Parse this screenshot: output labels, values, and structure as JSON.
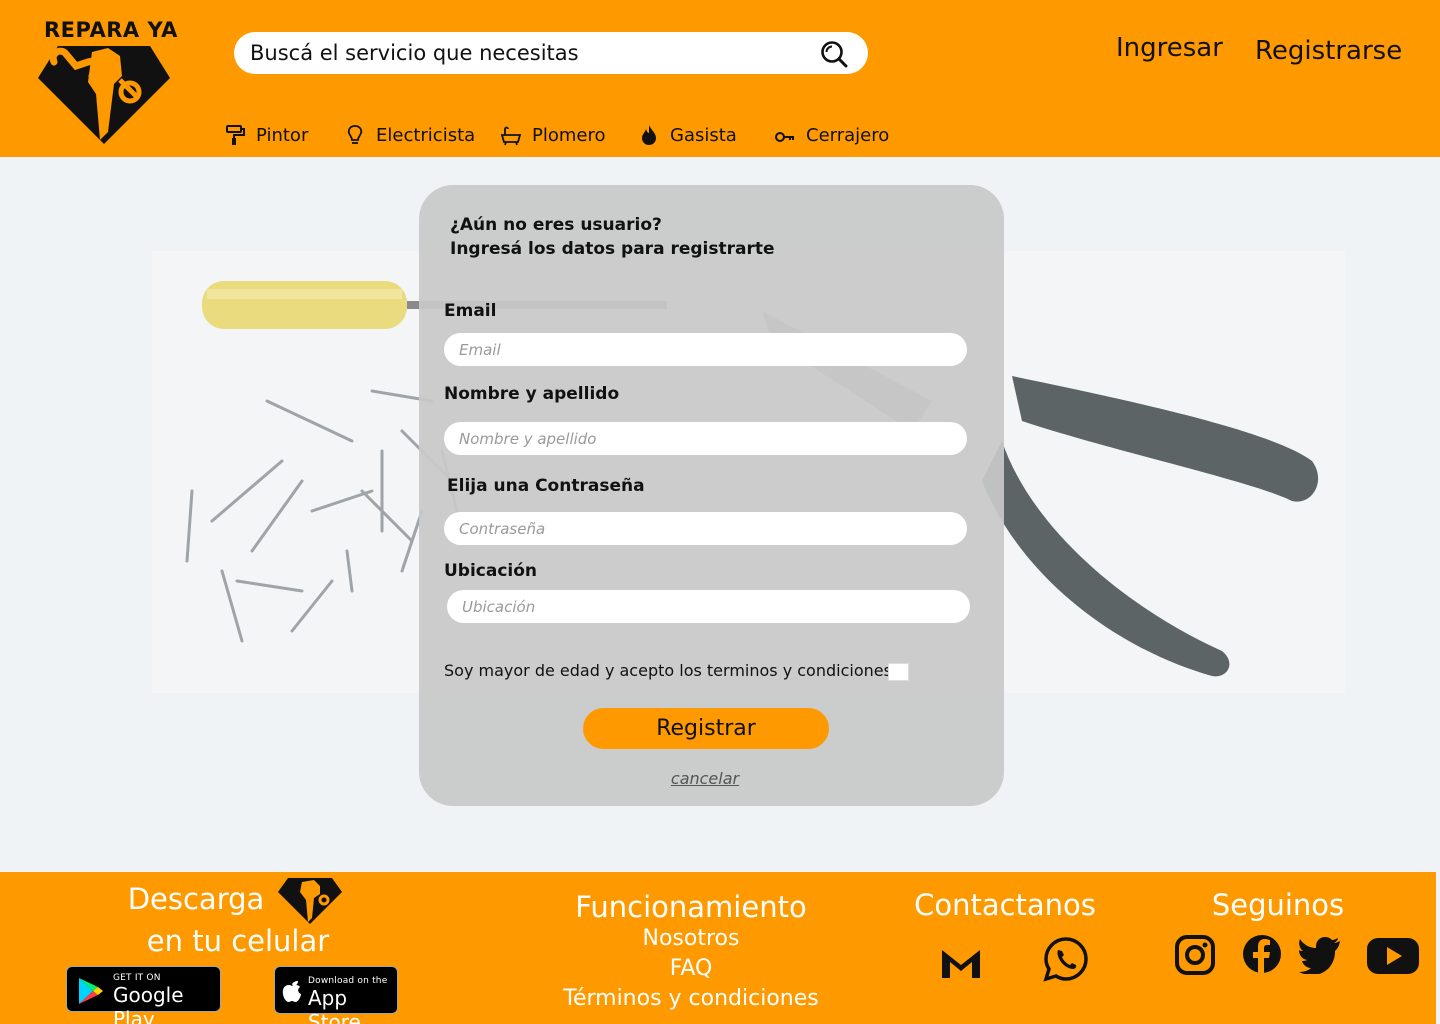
{
  "brand": {
    "name": "REPARA YA"
  },
  "search": {
    "placeholder": "Buscá el servicio que necesitas"
  },
  "auth": {
    "login": "Ingresar",
    "register": "Registrarse"
  },
  "nav": [
    {
      "label": "Pintor",
      "icon": "paint-roller-icon"
    },
    {
      "label": "Electricista",
      "icon": "lightbulb-icon"
    },
    {
      "label": "Plomero",
      "icon": "bathtub-icon"
    },
    {
      "label": "Gasista",
      "icon": "flame-icon"
    },
    {
      "label": "Cerrajero",
      "icon": "key-icon"
    }
  ],
  "form": {
    "intro_line1": "¿Aún no eres usuario?",
    "intro_line2": "Ingresá los datos para registrarte",
    "email_label": "Email",
    "email_placeholder": "Email",
    "name_label": "Nombre y apellido",
    "name_placeholder": "Nombre y apellido",
    "password_label": "Elija una Contraseña",
    "password_placeholder": "Contraseña",
    "location_label": "Ubicación",
    "location_placeholder": "Ubicación",
    "terms": "Soy mayor de edad y acepto los terminos y condiciones.",
    "submit": "Registrar",
    "cancel": "cancelar"
  },
  "footer": {
    "download_line1": "Descarga",
    "download_line2": "en tu celular",
    "google_small": "GET IT ON",
    "google_big": "Google Play",
    "apple_small": "Download on the",
    "apple_big": "App Store",
    "how_title": "Funcionamiento",
    "links": [
      "Nosotros",
      "FAQ",
      "Términos y condiciones"
    ],
    "contact_title": "Contactanos",
    "follow_title": "Seguinos"
  },
  "colors": {
    "brand_orange": "#ff9900",
    "page_bg": "#eff3f6",
    "card_gray": "#c8c8c8"
  }
}
